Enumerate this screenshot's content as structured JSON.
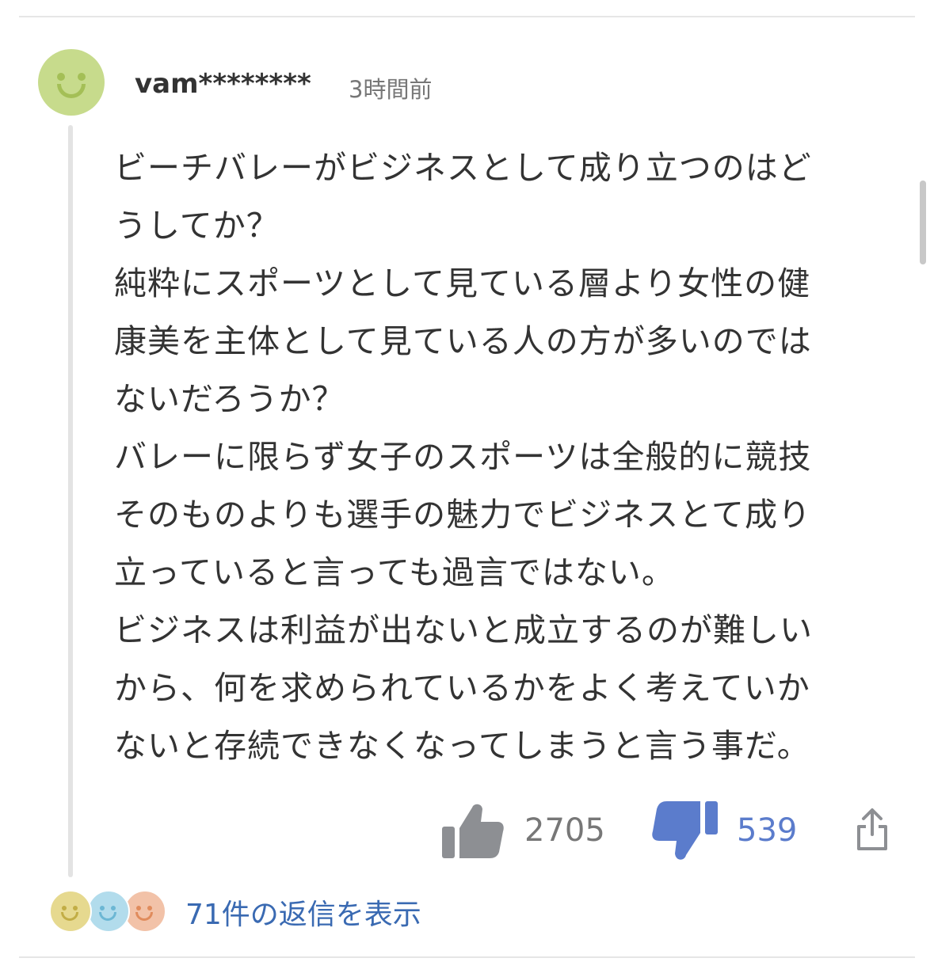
{
  "comment": {
    "username": "vam********",
    "timestamp": "3時間前",
    "lines": [
      "ビーチバレーがビジネスとして成り立つのはど",
      "うしてか？",
      "純粋にスポーツとして見ている層より女性の健",
      "康美を主体として見ている人の方が多いのでは",
      "ないだろうか？",
      "バレーに限らず女子のスポーツは全般的に競技",
      "そのものよりも選手の魅力でビジネスとて成り",
      "立っていると言っても過言ではない。",
      "ビジネスは利益が出ないと成立するのが難しい",
      "から、何を求められているかをよく考えていか",
      "ないと存続できなくなってしまうと言う事だ。"
    ],
    "reactions": {
      "like_icon": "thumbs-up-icon",
      "like_count": "2705",
      "dislike_icon": "thumbs-down-icon",
      "dislike_count": "539",
      "share_icon": "share-icon"
    },
    "replies": {
      "label": "71件の返信を表示"
    }
  },
  "colors": {
    "avatar_main": "#c7db8c",
    "like_icon": "#8d8f93",
    "dislike_icon": "#5b7ccc",
    "link": "#3a6ab2",
    "text": "#333333",
    "meta": "#777777"
  }
}
